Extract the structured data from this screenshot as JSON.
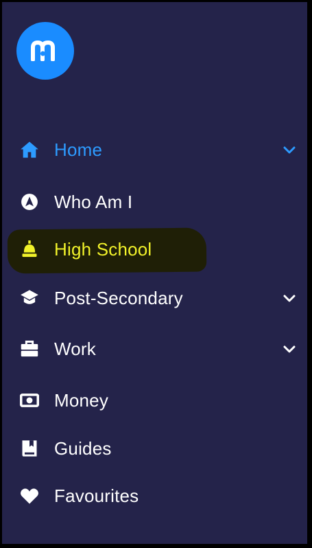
{
  "brand": {
    "logo_icon": "mm-logo-icon",
    "logo_color": "#1a8cff"
  },
  "colors": {
    "sidebar_bg": "#24234a",
    "active": "#2d9bff",
    "highlight_text": "#f1f22a",
    "default_text": "#ffffff"
  },
  "nav": {
    "items": [
      {
        "label": "Home",
        "icon": "home-icon",
        "state": "active",
        "has_submenu": true
      },
      {
        "label": "Who Am I",
        "icon": "compass-icon",
        "state": "default",
        "has_submenu": false
      },
      {
        "label": "High School",
        "icon": "bell-icon",
        "state": "highlighted",
        "has_submenu": false
      },
      {
        "label": "Post-Secondary",
        "icon": "graduation-cap-icon",
        "state": "default",
        "has_submenu": true
      },
      {
        "label": "Work",
        "icon": "briefcase-icon",
        "state": "default",
        "has_submenu": true
      },
      {
        "label": "Money",
        "icon": "money-icon",
        "state": "default",
        "has_submenu": false
      },
      {
        "label": "Guides",
        "icon": "book-icon",
        "state": "default",
        "has_submenu": false
      },
      {
        "label": "Favourites",
        "icon": "heart-icon",
        "state": "default",
        "has_submenu": false
      }
    ]
  }
}
